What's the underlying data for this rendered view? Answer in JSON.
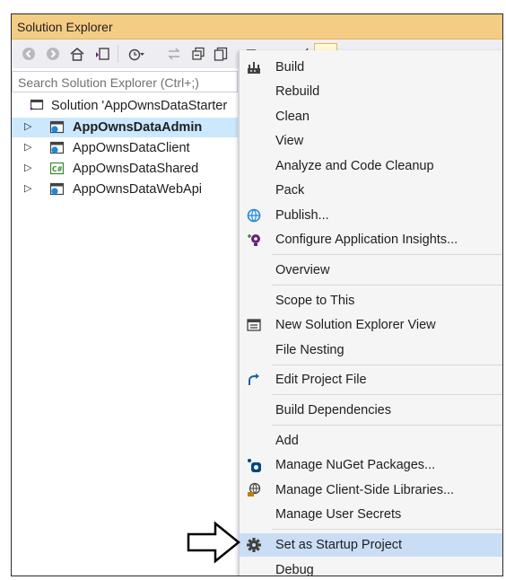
{
  "window": {
    "title": "Solution Explorer"
  },
  "search": {
    "placeholder": "Search Solution Explorer (Ctrl+;)"
  },
  "tree": {
    "solution": "Solution 'AppOwnsDataStarter",
    "projects": [
      {
        "label": "AppOwnsDataAdmin",
        "icon": "web-project-icon",
        "selected": true
      },
      {
        "label": "AppOwnsDataClient",
        "icon": "web-project-icon",
        "selected": false
      },
      {
        "label": "AppOwnsDataShared",
        "icon": "csharp-project-icon",
        "selected": false
      },
      {
        "label": "AppOwnsDataWebApi",
        "icon": "web-project-icon",
        "selected": false
      }
    ]
  },
  "context_menu": {
    "items": [
      {
        "label": "Build",
        "icon": "build-icon"
      },
      {
        "label": "Rebuild"
      },
      {
        "label": "Clean"
      },
      {
        "label": "View"
      },
      {
        "label": "Analyze and Code Cleanup"
      },
      {
        "label": "Pack"
      },
      {
        "label": "Publish...",
        "icon": "publish-globe-icon"
      },
      {
        "label": "Configure Application Insights...",
        "icon": "insights-bulb-icon"
      },
      {
        "label": "Overview"
      },
      {
        "label": "Scope to This"
      },
      {
        "label": "New Solution Explorer View",
        "icon": "new-view-icon"
      },
      {
        "label": "File Nesting"
      },
      {
        "label": "Edit Project File",
        "icon": "edit-project-arrow-icon"
      },
      {
        "label": "Build Dependencies"
      },
      {
        "label": "Add"
      },
      {
        "label": "Manage NuGet Packages...",
        "icon": "nuget-icon"
      },
      {
        "label": "Manage Client-Side Libraries...",
        "icon": "client-libraries-icon"
      },
      {
        "label": "Manage User Secrets"
      },
      {
        "label": "Set as Startup Project",
        "icon": "gear-icon",
        "highlighted": true
      },
      {
        "label": "Debug"
      }
    ]
  },
  "colors": {
    "title_bar": "#f5cc84",
    "selection": "#cce8ff",
    "menu_highlight": "#c9def5"
  }
}
